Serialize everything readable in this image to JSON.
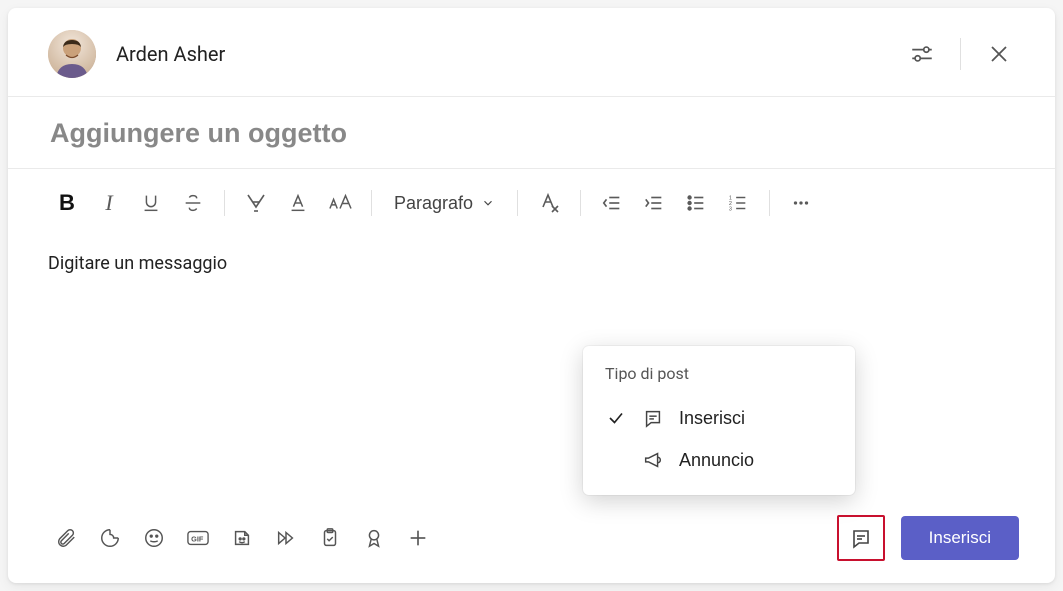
{
  "header": {
    "user_name": "Arden Asher"
  },
  "subject": {
    "placeholder": "Aggiungere un oggetto",
    "value": ""
  },
  "toolbar": {
    "style_label": "Paragrafo"
  },
  "message": {
    "placeholder": "Digitare un messaggio",
    "value": ""
  },
  "popup": {
    "title": "Tipo di post",
    "items": [
      {
        "label": "Inserisci",
        "selected": true
      },
      {
        "label": "Annuncio",
        "selected": false
      }
    ]
  },
  "submit": {
    "label": "Inserisci"
  }
}
